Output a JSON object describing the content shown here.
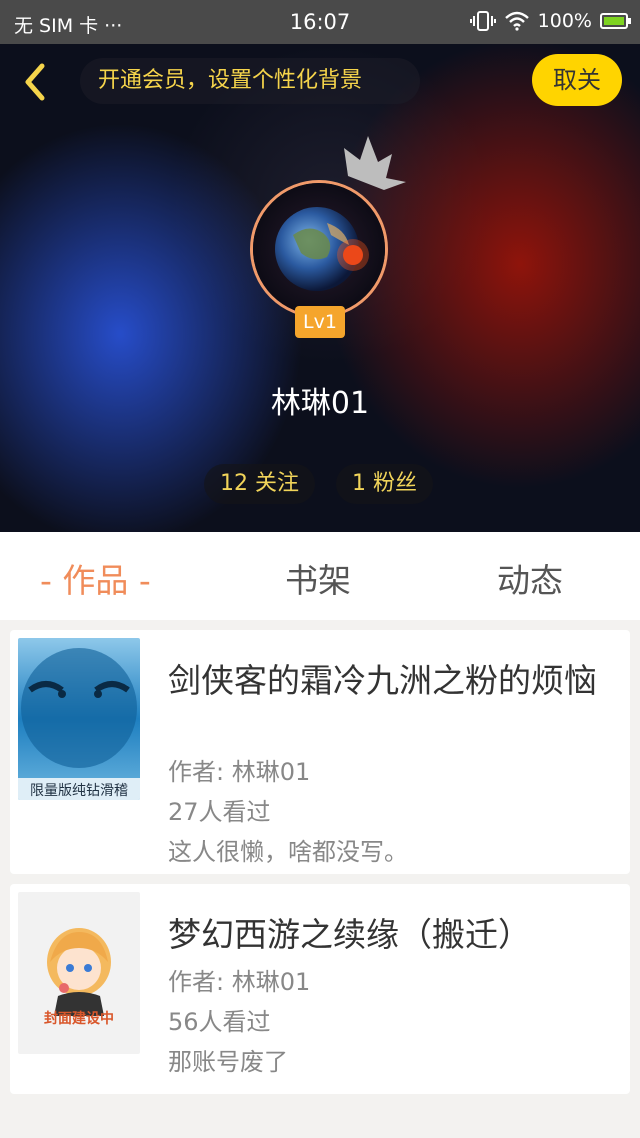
{
  "status_bar": {
    "carrier": "无 SIM 卡 ···",
    "time": "16:07",
    "battery": "100%"
  },
  "header": {
    "promo_text": "开通会员，设置个性化背景",
    "cancel_label": "取关",
    "level": "Lv1",
    "username": "林琳01",
    "following": "12 关注",
    "followers": "1 粉丝"
  },
  "tabs": [
    {
      "label": "- 作品 -"
    },
    {
      "label": "书架"
    },
    {
      "label": "动态"
    }
  ],
  "works": [
    {
      "title": "剑侠客的霜冷九洲之粉的烦恼",
      "author": "作者: 林琳01",
      "views": "27人看过",
      "desc": "这人很懒，啥都没写。",
      "cover_text": "限量版纯钻滑稽"
    },
    {
      "title": "梦幻西游之续缘（搬迁）",
      "author": "作者: 林琳01",
      "views": "56人看过",
      "desc": "那账号废了",
      "cover_text": "封面建设中"
    }
  ],
  "colors": {
    "accent": "#f08c5a",
    "vip_yellow": "#ffd400",
    "gold_text": "#f5d44b"
  }
}
